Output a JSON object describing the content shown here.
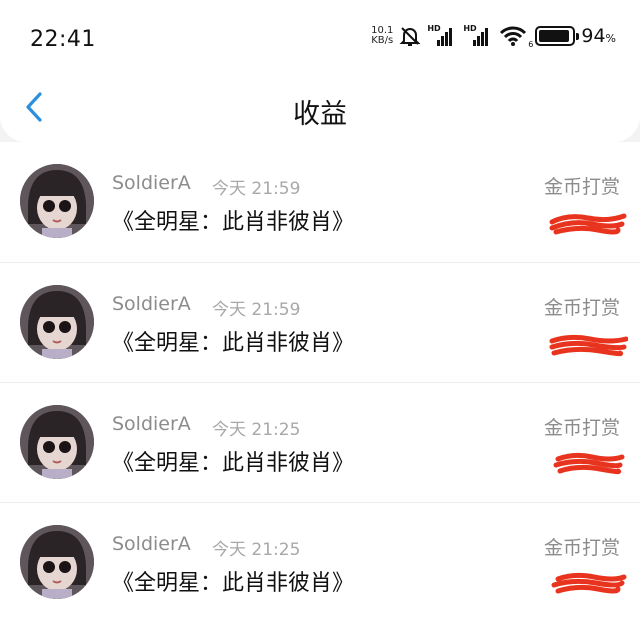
{
  "status_bar": {
    "time": "22:41",
    "net_speed_value": "10.1",
    "net_speed_unit": "KB/s",
    "hd_label": "HD",
    "wifi_sub": "6",
    "battery_percent": "94",
    "battery_unit": "%"
  },
  "header": {
    "title": "收益"
  },
  "records": [
    {
      "name": "SoldierA",
      "time": "今天 21:59",
      "work": "《全明星：此肖非彼肖》",
      "type": "金币打赏"
    },
    {
      "name": "SoldierA",
      "time": "今天 21:59",
      "work": "《全明星：此肖非彼肖》",
      "type": "金币打赏"
    },
    {
      "name": "SoldierA",
      "time": "今天 21:25",
      "work": "《全明星：此肖非彼肖》",
      "type": "金币打赏"
    },
    {
      "name": "SoldierA",
      "time": "今天 21:25",
      "work": "《全明星：此肖非彼肖》",
      "type": "金币打赏"
    }
  ],
  "colors": {
    "accent": "#2b8fe0",
    "redaction": "#e8341e"
  }
}
